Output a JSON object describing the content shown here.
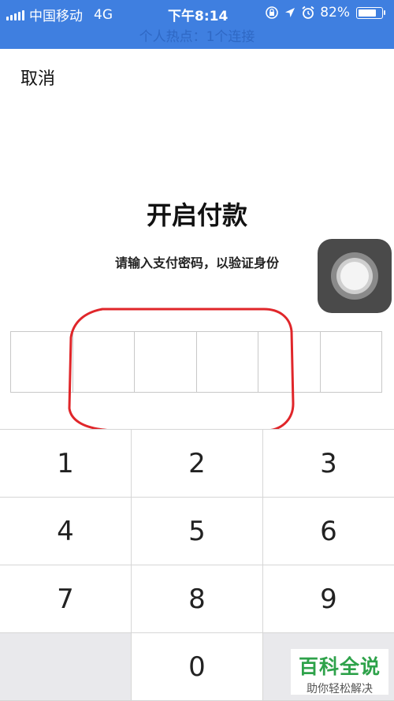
{
  "status_bar": {
    "carrier": "中国移动",
    "network": "4G",
    "time": "下午8:14",
    "battery_text": "82%",
    "battery_level": 0.82
  },
  "hotspot": {
    "text": "个人热点：1个连接"
  },
  "header": {
    "cancel_label": "取消"
  },
  "main": {
    "title": "开启付款",
    "subtitle": "请输入支付密码，以验证身份"
  },
  "pin": {
    "length": 6
  },
  "keypad": {
    "keys": [
      "1",
      "2",
      "3",
      "4",
      "5",
      "6",
      "7",
      "8",
      "9",
      "",
      "0",
      ""
    ]
  },
  "annotation": {
    "color": "#e0262a"
  },
  "watermark": {
    "title": "百科全说",
    "subtitle": "助你轻松解决"
  }
}
